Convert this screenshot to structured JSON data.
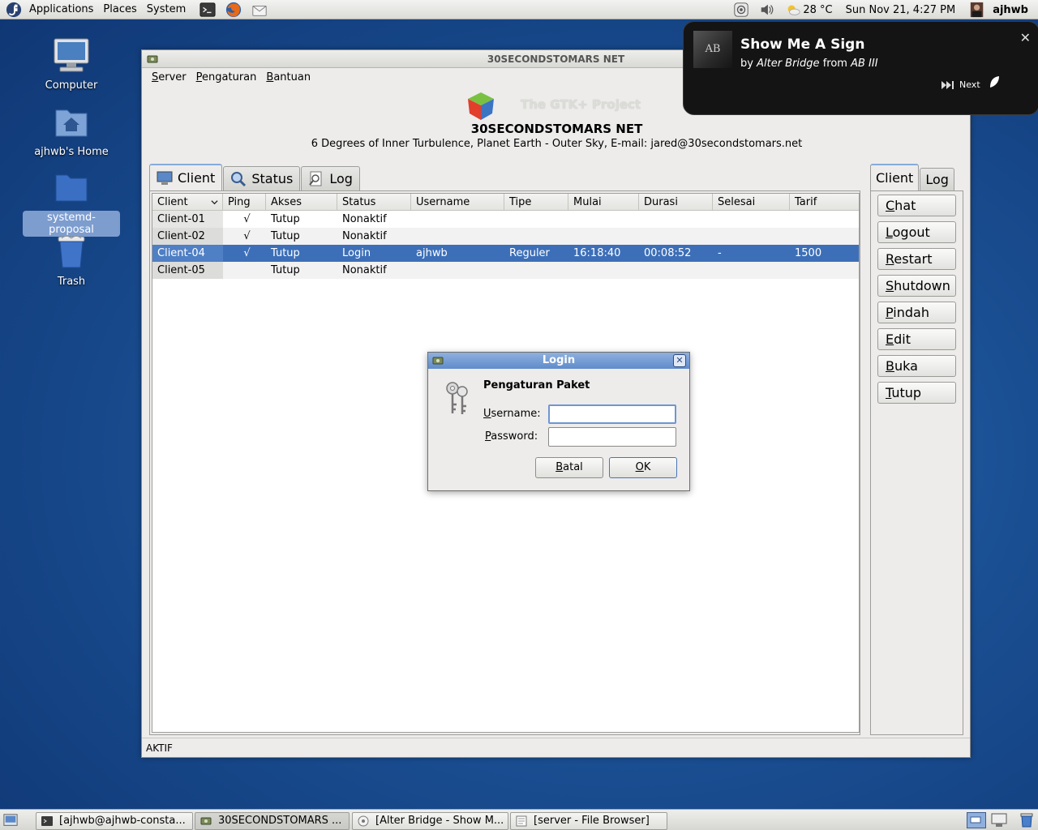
{
  "top_panel": {
    "menus": [
      "Applications",
      "Places",
      "System"
    ],
    "weather": "28 °C",
    "clock": "Sun Nov 21,  4:27 PM",
    "user": "ajhwb"
  },
  "desktop_icons": [
    {
      "label": "Computer"
    },
    {
      "label": "ajhwb's Home"
    },
    {
      "label": "systemd-proposal"
    },
    {
      "label": "Trash"
    }
  ],
  "window": {
    "title": "30SECONDSTOMARS NET",
    "menu": [
      "Server",
      "Pengaturan",
      "Bantuan"
    ],
    "gtk_project": "The GTK+ Project",
    "app_name": "30SECONDSTOMARS NET",
    "app_desc": "6 Degrees of Inner Turbulence, Planet Earth - Outer Sky, E-mail: jared@30secondstomars.net",
    "tabs": [
      "Client",
      "Status",
      "Log"
    ],
    "right_tabs": [
      "Client",
      "Log"
    ],
    "table": {
      "columns": [
        "Client",
        "Ping",
        "Akses",
        "Status",
        "Username",
        "Tipe",
        "Mulai",
        "Durasi",
        "Selesai",
        "Tarif"
      ],
      "rows": [
        [
          "Client-01",
          "√",
          "Tutup",
          "Nonaktif",
          "",
          "",
          "",
          "",
          "",
          ""
        ],
        [
          "Client-02",
          "√",
          "Tutup",
          "Nonaktif",
          "",
          "",
          "",
          "",
          "",
          ""
        ],
        [
          "Client-04",
          "√",
          "Tutup",
          "Login",
          "ajhwb",
          "Reguler",
          "16:18:40",
          "00:08:52",
          "-",
          "1500"
        ],
        [
          "Client-05",
          "",
          "Tutup",
          "Nonaktif",
          "",
          "",
          "",
          "",
          "",
          ""
        ]
      ]
    },
    "buttons": [
      "Chat",
      "Logout",
      "Restart",
      "Shutdown",
      "Pindah",
      "Edit",
      "Buka",
      "Tutup"
    ],
    "status": "AKTIF"
  },
  "login_dialog": {
    "title": "Login",
    "heading": "Pengaturan Paket",
    "username_label": "Username:",
    "password_label": "Password:",
    "username_value": "",
    "password_value": "",
    "cancel_label": "Batal",
    "ok_label": "OK"
  },
  "notification": {
    "title": "Show Me A Sign",
    "by": "by",
    "artist": "Alter Bridge",
    "from": "from",
    "album": "AB III",
    "next_label": "Next",
    "art_text": "AB"
  },
  "taskbar": [
    {
      "label": "[ajhwb@ajhwb-consta..."
    },
    {
      "label": "30SECONDSTOMARS ..."
    },
    {
      "label": "[Alter Bridge - Show M..."
    },
    {
      "label": "[server - File Browser]"
    }
  ]
}
